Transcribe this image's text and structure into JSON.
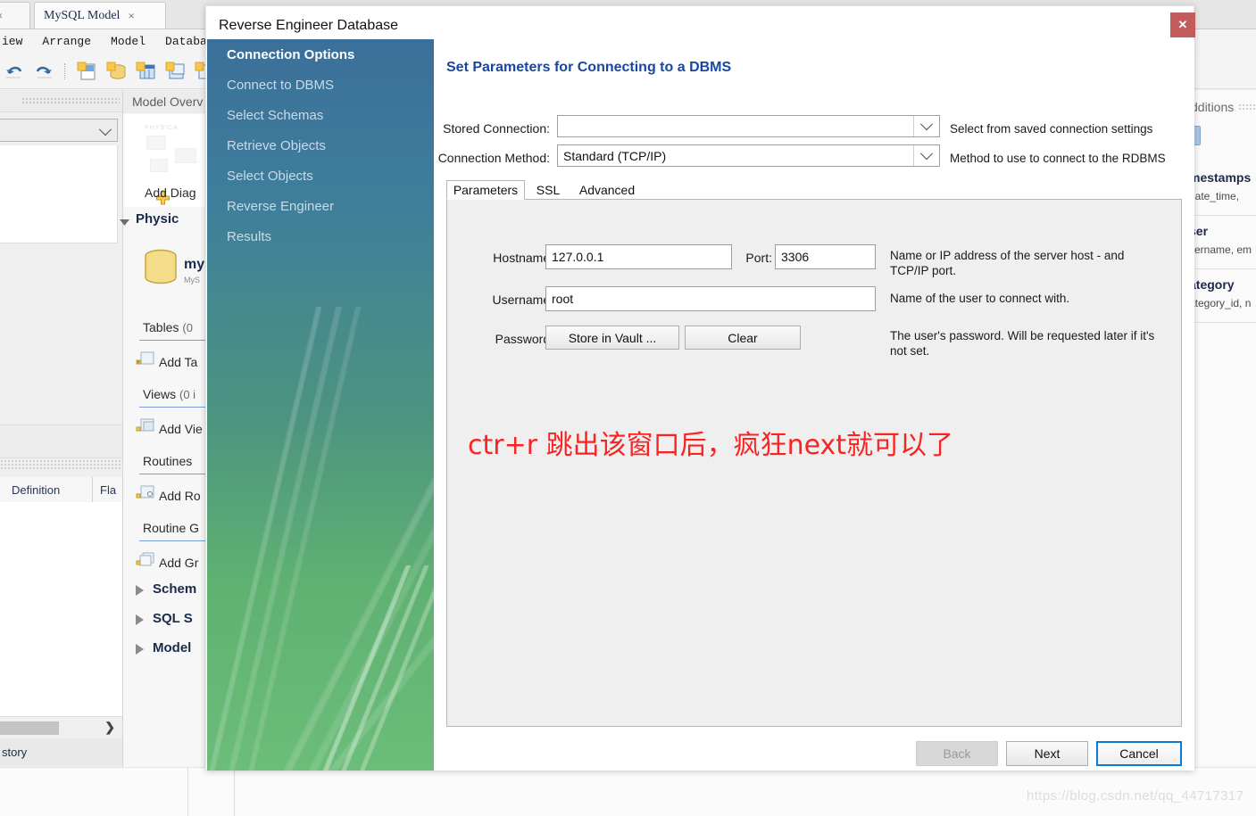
{
  "background_app": {
    "tabs": [
      {
        "label": "t",
        "close": "×"
      },
      {
        "label": "MySQL Model",
        "close": "×"
      }
    ],
    "menu": [
      "iew",
      "Arrange",
      "Model",
      "Database"
    ],
    "toolbar_icons": [
      "undo-icon",
      "redo-icon",
      "new-model-icon",
      "new-schema-icon",
      "new-table-icon",
      "new-view-icon",
      "new-routine-icon"
    ],
    "left_panel": {
      "tab_definition": "Definition",
      "tab_flags": "Fla",
      "history_label": "story"
    },
    "model_overview": {
      "header": "Model Overv",
      "card_badge": "PHYSICA",
      "add_diagram": "Add Diag",
      "physical_section": "Physic",
      "db_name": "my",
      "db_sub": "MyS",
      "rows": [
        {
          "label": "Tables",
          "count": "(0",
          "add": "Add Ta"
        },
        {
          "label": "Views",
          "count": "(0 i",
          "add": "Add Vie"
        },
        {
          "label": "Routines",
          "count": "",
          "add": "Add Ro"
        },
        {
          "label": "Routine G",
          "count": "",
          "add": "Add Gr"
        }
      ],
      "sections": [
        "Schem",
        "SQL S",
        "Model"
      ]
    },
    "additions_panel": {
      "header": "dditions",
      "items": [
        {
          "title": "mestamps",
          "sub": "eate_time, "
        },
        {
          "title": "ser",
          "sub": "sername, em"
        },
        {
          "title": "ategory",
          "sub": "ategory_id, n"
        }
      ]
    },
    "watermark": "https://blog.csdn.net/qq_44717317"
  },
  "dialog": {
    "title": "Reverse Engineer Database",
    "close_label": "✕",
    "nav_items": [
      {
        "label": "Connection Options",
        "active": true
      },
      {
        "label": "Connect to DBMS",
        "active": false
      },
      {
        "label": "Select Schemas",
        "active": false
      },
      {
        "label": "Retrieve Objects",
        "active": false
      },
      {
        "label": "Select Objects",
        "active": false
      },
      {
        "label": "Reverse Engineer",
        "active": false
      },
      {
        "label": "Results",
        "active": false
      }
    ],
    "heading": "Set Parameters for Connecting to a DBMS",
    "stored_connection": {
      "label": "Stored Connection:",
      "value": "",
      "hint": "Select from saved connection settings"
    },
    "connection_method": {
      "label": "Connection Method:",
      "value": "Standard (TCP/IP)",
      "hint": "Method to use to connect to the RDBMS"
    },
    "tabs": [
      {
        "label": "Parameters",
        "selected": true
      },
      {
        "label": "SSL",
        "selected": false
      },
      {
        "label": "Advanced",
        "selected": false
      }
    ],
    "parameters": {
      "hostname": {
        "label": "Hostname:",
        "value": "127.0.0.1"
      },
      "port": {
        "label": "Port:",
        "value": "3306"
      },
      "host_hint": "Name or IP address of the server host - and TCP/IP port.",
      "username": {
        "label": "Username:",
        "value": "root"
      },
      "username_hint": "Name of the user to connect with.",
      "password": {
        "label": "Password:",
        "store_button": "Store in Vault ...",
        "clear_button": "Clear",
        "hint": "The user's password. Will be requested later if it's not set."
      }
    },
    "footer_buttons": {
      "back": "Back",
      "next": "Next",
      "cancel": "Cancel"
    }
  },
  "annotation": {
    "text": "ctr+r  跳出该窗口后，疯狂next就可以了",
    "color": "#fb2222"
  }
}
